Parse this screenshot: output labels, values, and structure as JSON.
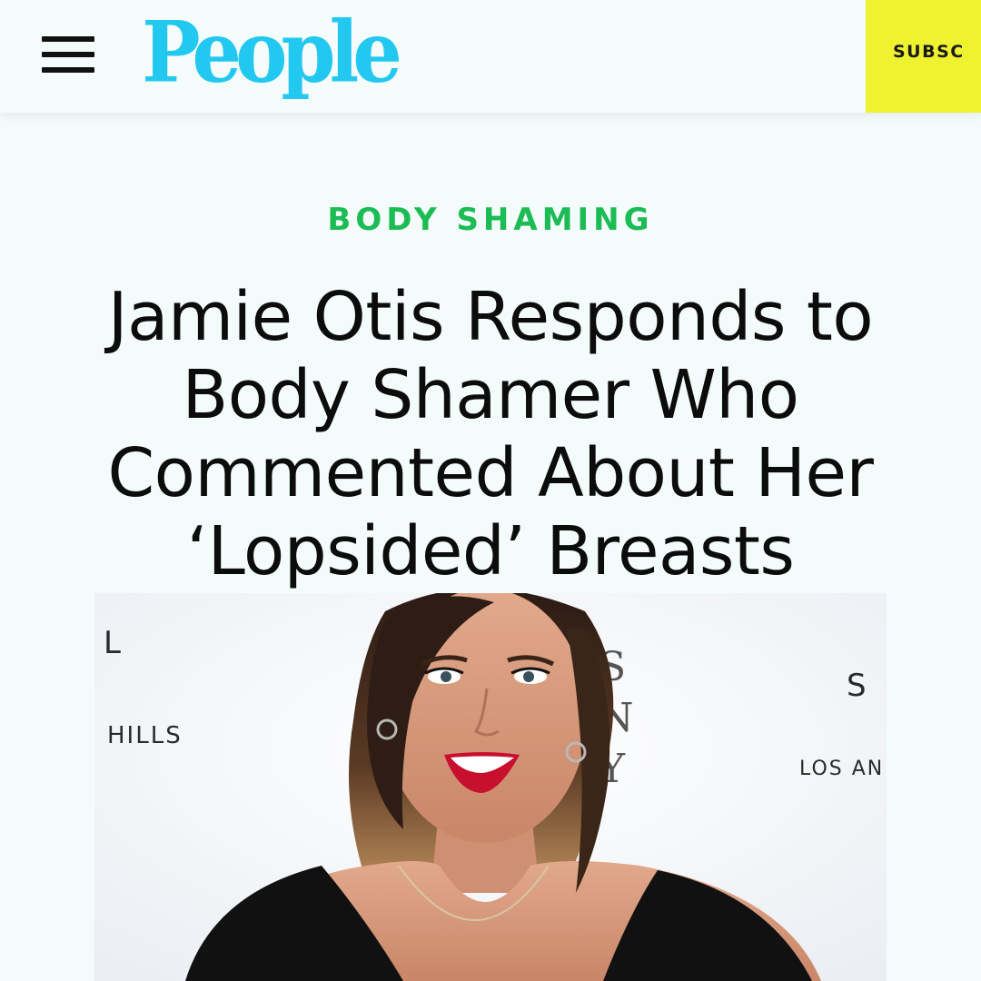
{
  "header": {
    "menu_icon": "hamburger-menu-icon",
    "logo_text": "People",
    "subscribe_label": "SUBSC",
    "colors": {
      "logo": "#23c8f0",
      "subscribe_bg": "#eef22f"
    }
  },
  "article": {
    "kicker": "BODY SHAMING",
    "headline": "Jamie Otis Responds to Body Shamer Who Commented About Her ‘Lopsided’ Breasts",
    "kicker_color": "#1cbc55"
  },
  "photo": {
    "backdrop_text": {
      "l": "L",
      "hills": "HILLS",
      "s": "S",
      "los_an": "LOS AN",
      "sny": [
        "S",
        "N",
        "Y"
      ]
    }
  }
}
